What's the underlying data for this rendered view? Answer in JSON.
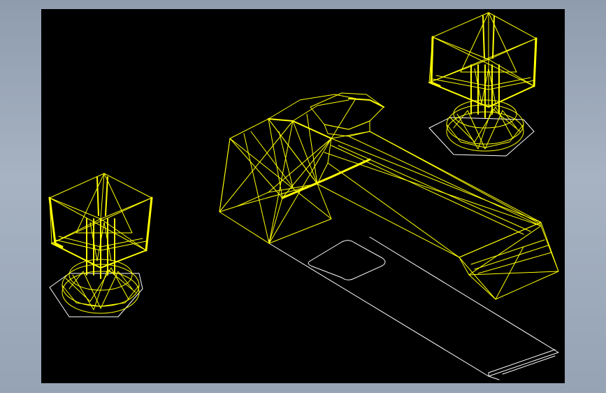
{
  "viewport": {
    "background": "#000000",
    "frame_background": "#a3afbf"
  },
  "drawing": {
    "wire_color": "#ffff00",
    "outline_color": "#ffffff",
    "objects": [
      {
        "name": "left-handle",
        "kind": "faucet handle"
      },
      {
        "name": "spout",
        "kind": "faucet spout"
      },
      {
        "name": "right-handle",
        "kind": "faucet handle"
      },
      {
        "name": "spout-base-plate",
        "kind": "base plate outline"
      }
    ]
  }
}
